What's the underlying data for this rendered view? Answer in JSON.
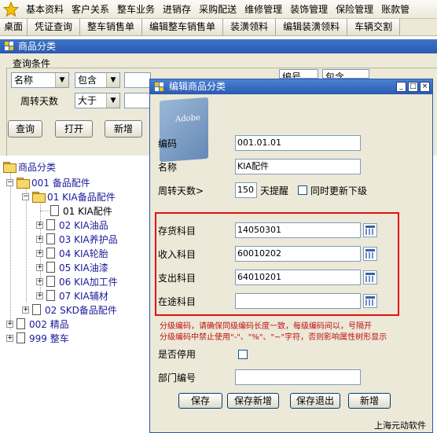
{
  "menubar": {
    "items": [
      "基本资料",
      "客户关系",
      "整车业务",
      "进销存",
      "采购配送",
      "维修管理",
      "装饰管理",
      "保险管理",
      "账款管"
    ]
  },
  "toolbar": {
    "tabs": [
      "桌面",
      "凭证查询",
      "整车销售单",
      "编辑整车销售单",
      "装潢领料",
      "编辑装潢领料",
      "车辆交割"
    ]
  },
  "main_window": {
    "title": "商品分类",
    "query": {
      "group_label": "查询条件",
      "field1": "名称",
      "op1": "包含",
      "field2_label": "周转天数",
      "op2": "大于",
      "field3_partial": "编号",
      "op3_partial": "包含"
    },
    "buttons": {
      "query": "查询",
      "open": "打开",
      "new": "新增"
    }
  },
  "tree": {
    "root": "商品分类",
    "nodes": [
      {
        "label": "001 备品配件"
      },
      {
        "label": "01 KIA备品配件"
      },
      {
        "label": "01 KIA配件"
      },
      {
        "label": "02 KIA油品"
      },
      {
        "label": "03 KIA养护品"
      },
      {
        "label": "04 KIA轮胎"
      },
      {
        "label": "05 KIA油漆"
      },
      {
        "label": "06 KIA加工件"
      },
      {
        "label": "07 KIA辅材"
      },
      {
        "label": "02 SKD备品配件"
      },
      {
        "label": "002 精品"
      },
      {
        "label": "999 整车"
      }
    ]
  },
  "dialog": {
    "title": "编辑商品分类",
    "logo_text": "Adobe",
    "fields": {
      "code_label": "编码",
      "code_value": "001.01.01",
      "name_label": "名称",
      "name_value": "KIA配件",
      "turnover_label": "周转天数>",
      "turnover_value": "150",
      "remind_label": "天提醒",
      "sync_label": "同时更新下级",
      "inventory_label": "存货科目",
      "inventory_value": "14050301",
      "income_label": "收入科目",
      "income_value": "60010202",
      "expense_label": "支出科目",
      "expense_value": "64010201",
      "transit_label": "在途科目",
      "transit_value": "",
      "disabled_label": "是否停用",
      "dept_label": "部门编号",
      "dept_value": ""
    },
    "hint_line1": "分级编码，请确保同级编码长度一致，每级编码间以，号隔开",
    "hint_line2": "分级编码中禁止使用\"-\"、\"%\"、\"~\"字符，否则影响属性树形显示",
    "buttons": {
      "save": "保存",
      "save_new": "保存新增",
      "save_exit": "保存退出",
      "new": "新增"
    },
    "footer": "上海元动软件"
  },
  "colors": {
    "titlebar": "#2a5ab0",
    "panel": "#ece9d8",
    "hint_red": "#c01010",
    "highlight_box": "#e01010",
    "tree_text": "#1a1a9a"
  }
}
